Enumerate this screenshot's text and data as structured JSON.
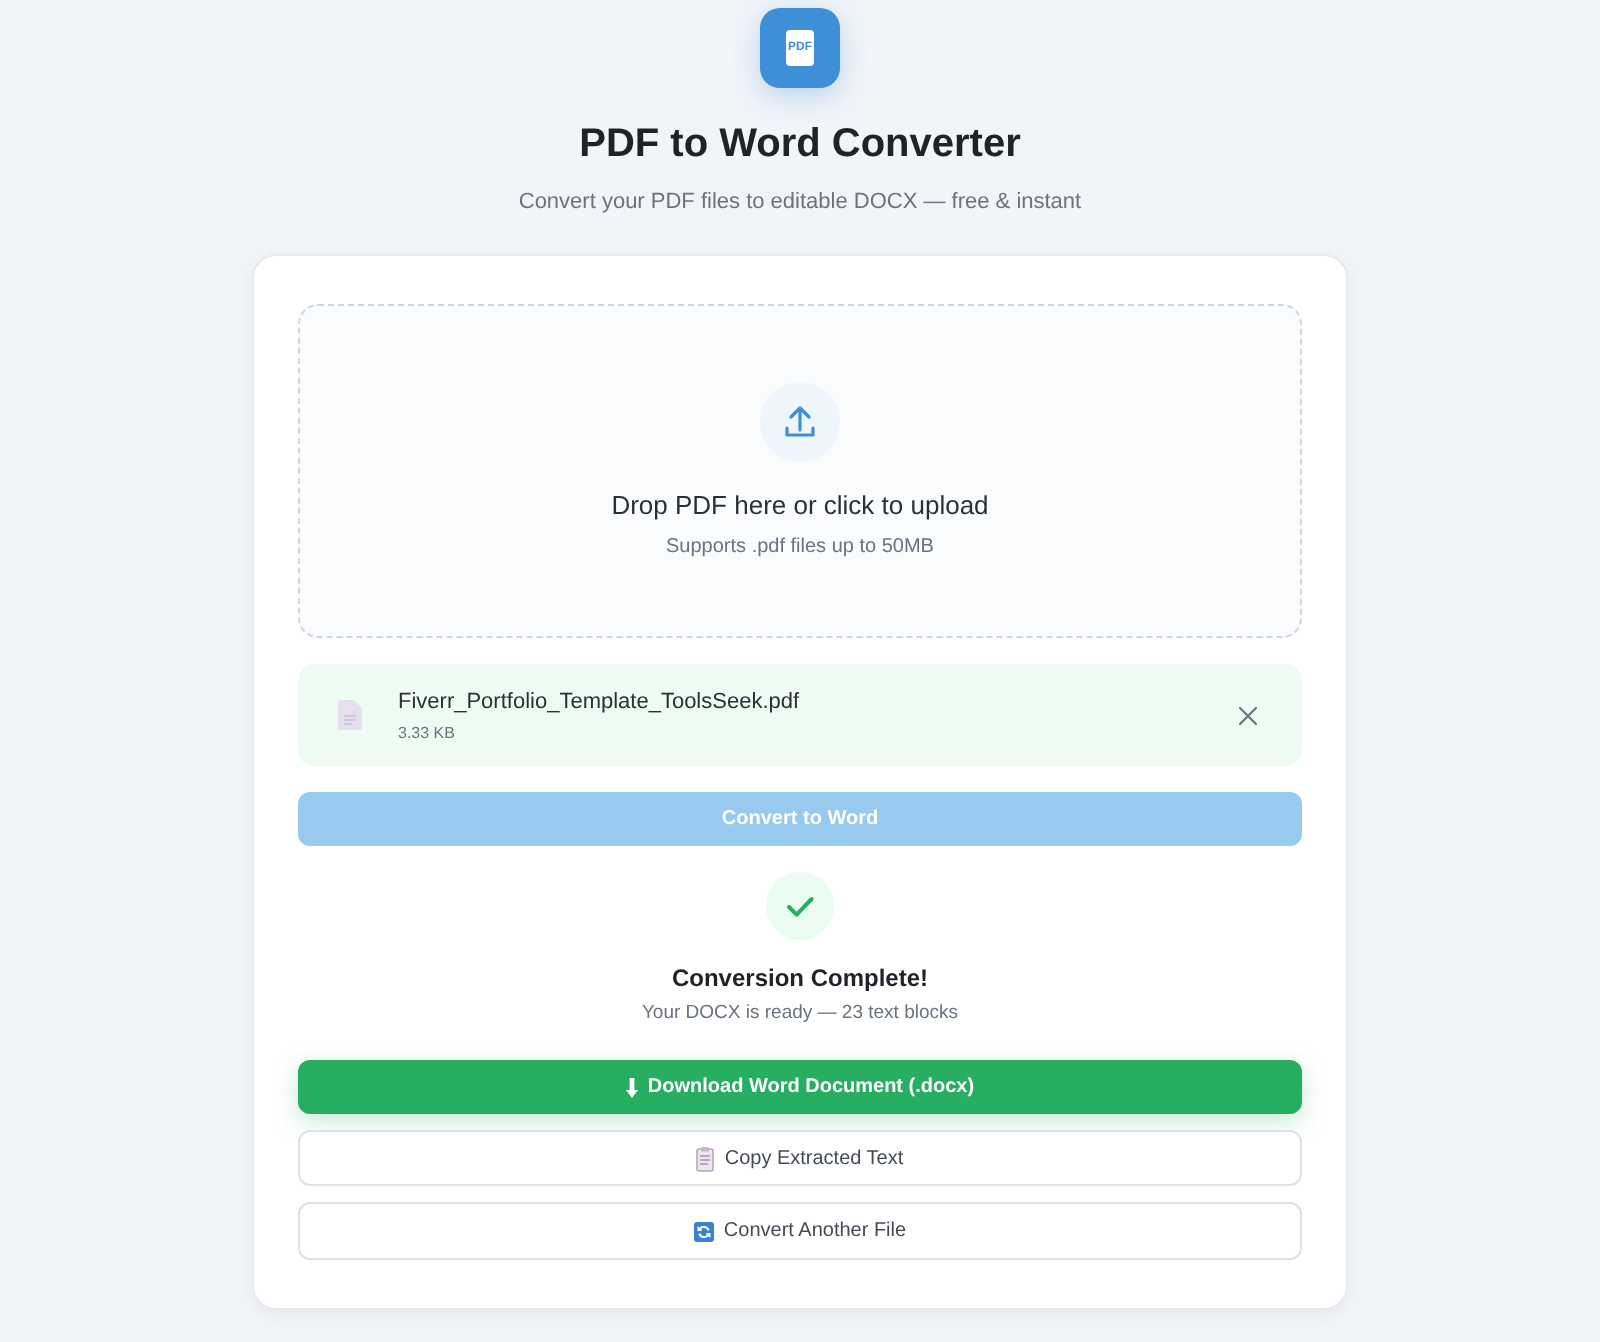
{
  "header": {
    "logo_text": "PDF",
    "title": "PDF to Word Converter",
    "subtitle": "Convert your PDF files to editable DOCX — free & instant"
  },
  "dropzone": {
    "title": "Drop PDF here or click to upload",
    "hint": "Supports .pdf files up to 50MB"
  },
  "file": {
    "name": "Fiverr_Portfolio_Template_ToolsSeek.pdf",
    "size": "3.33 KB"
  },
  "convert_button": {
    "label": "Convert to Word",
    "disabled": true
  },
  "result": {
    "title": "Conversion Complete!",
    "message": "Your DOCX is ready — 23 text blocks"
  },
  "actions": [
    {
      "kind": "download",
      "label": "Download Word Document (.docx)"
    },
    {
      "kind": "copy",
      "label": "Copy Extracted Text"
    },
    {
      "kind": "restart",
      "label": "Convert Another File"
    }
  ]
}
